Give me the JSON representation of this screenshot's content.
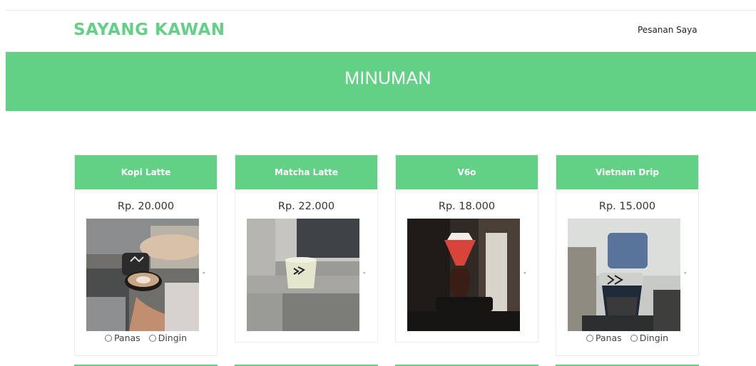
{
  "header": {
    "brand": "SAYANG KAWAN",
    "nav_link": "Pesanan Saya"
  },
  "banner": {
    "title": "MINUMAN"
  },
  "products": [
    {
      "name": "Kopi Latte",
      "price": "Rp. 20.000",
      "dash": "-",
      "options": [
        "Panas",
        "Dingin"
      ]
    },
    {
      "name": "Matcha Latte",
      "price": "Rp. 22.000",
      "dash": "-"
    },
    {
      "name": "V6o",
      "price": "Rp. 18.000",
      "dash": "-"
    },
    {
      "name": "Vietnam Drip",
      "price": "Rp. 15.000",
      "dash": "-",
      "options": [
        "Panas",
        "Dingin"
      ]
    }
  ],
  "colors": {
    "accent": "#63d185",
    "text": "#333333"
  }
}
